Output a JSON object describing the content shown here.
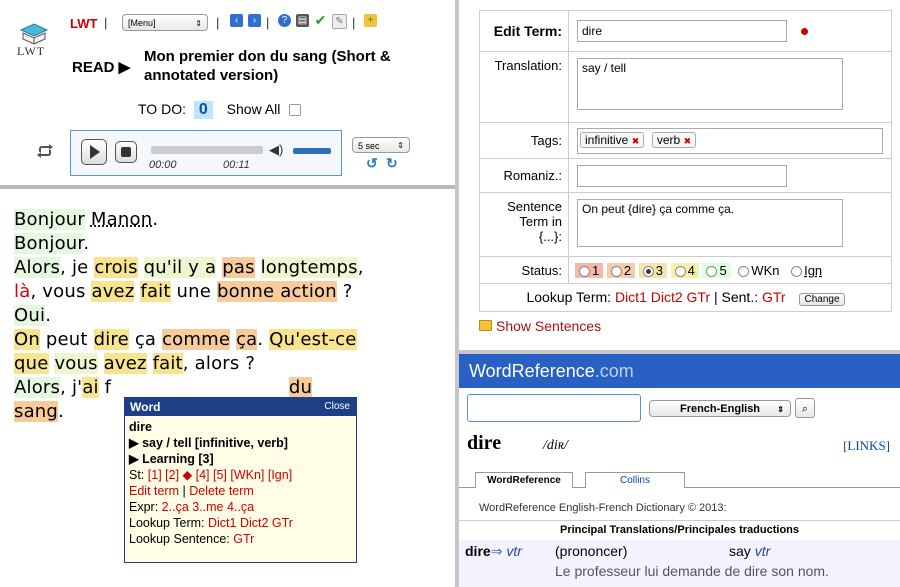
{
  "header": {
    "logo_text": "LWT",
    "app_label": "LWT",
    "menu_select": "[Menu]",
    "read_label": "READ ▶",
    "title": "Mon premier don du sang (Short & annotated version)",
    "todo_label": "TO DO:",
    "todo_count": "0",
    "show_all_label": "Show All"
  },
  "player": {
    "current_time": "00:00",
    "duration": "00:11",
    "progress_fraction": 0,
    "volume_fraction": 0.9,
    "skip_select": "5 sec"
  },
  "reading": {
    "lines": [
      [
        {
          "t": "Bonjour",
          "c": "s5"
        },
        {
          "t": " "
        },
        {
          "t": "Manon",
          "c": "ign"
        },
        {
          "t": "."
        }
      ],
      [
        {
          "t": "Bonjour",
          "c": "s5"
        },
        {
          "t": "."
        }
      ],
      [
        {
          "t": "Alors",
          "c": "s5"
        },
        {
          "t": ", je "
        },
        {
          "t": "crois",
          "c": "s3"
        },
        {
          "t": " "
        },
        {
          "t": "qu'il y a",
          "c": "s4"
        },
        {
          "t": " "
        },
        {
          "t": "pas",
          "c": "s2"
        },
        {
          "t": " "
        },
        {
          "t": "longtemps",
          "c": "s4"
        },
        {
          "t": ","
        }
      ],
      [
        {
          "t": "là",
          "c": "redw"
        },
        {
          "t": ", vous "
        },
        {
          "t": "avez",
          "c": "s3"
        },
        {
          "t": " "
        },
        {
          "t": "fait",
          "c": "s3"
        },
        {
          "t": " une "
        },
        {
          "t": "bonne action",
          "c": "s2"
        },
        {
          "t": " ?"
        }
      ],
      [
        {
          "t": "Oui",
          "c": "s5"
        },
        {
          "t": "."
        }
      ],
      [
        {
          "t": "On",
          "c": "s3"
        },
        {
          "t": " peut "
        },
        {
          "t": "dire",
          "c": "s3"
        },
        {
          "t": " ça "
        },
        {
          "t": "comme",
          "c": "s2"
        },
        {
          "t": " "
        },
        {
          "t": "ça",
          "c": "s2"
        },
        {
          "t": ". "
        },
        {
          "t": "Qu'est-ce",
          "c": "s3"
        }
      ],
      [
        {
          "t": "que",
          "c": "s3"
        },
        {
          "t": " "
        },
        {
          "t": "vous",
          "c": "s4"
        },
        {
          "t": " "
        },
        {
          "t": "avez",
          "c": "s3"
        },
        {
          "t": " "
        },
        {
          "t": "fait",
          "c": "s3"
        },
        {
          "t": ", alors ?"
        }
      ],
      [
        {
          "t": "Alors",
          "c": "s5"
        },
        {
          "t": ", j'"
        },
        {
          "t": "ai",
          "c": "s3"
        },
        {
          "t": " f"
        },
        {
          "t": "                              "
        },
        {
          "t": "du",
          "c": "s2"
        }
      ],
      [
        {
          "t": "sang",
          "c": "s2"
        },
        {
          "t": "."
        }
      ]
    ]
  },
  "popup": {
    "title": "Word",
    "close": "Close",
    "term": "dire",
    "translation": "▶ say / tell [infinitive, verb]",
    "learning": "▶ Learning [3]",
    "status_prefix": "St:",
    "status_links": "[1] [2] ◆ [4] [5] [WKn] [Ign]",
    "edit_term": "Edit term",
    "sep": " | ",
    "delete_term": "Delete term",
    "expr_label": "Expr:",
    "expr_links": "2..ça 3..me 4..ça",
    "lookup_term_label": "Lookup Term:",
    "lookup_term_links": "Dict1 Dict2 GTr",
    "lookup_sentence_label": "Lookup Sentence:",
    "lookup_sentence_link": "GTr"
  },
  "form": {
    "edit_term_label": "Edit Term:",
    "edit_term_value": "dire",
    "translation_label": "Translation:",
    "translation_value": "say / tell",
    "tags_label": "Tags:",
    "tags": [
      "infinitive",
      "verb"
    ],
    "romaniz_label": "Romaniz.:",
    "romaniz_value": "",
    "sentence_label_1": "Sentence",
    "sentence_label_2": "Term in",
    "sentence_label_3": "{...}:",
    "sentence_value": "On peut {dire} ça comme ça.",
    "status_label": "Status:",
    "status_options": [
      "1",
      "2",
      "3",
      "4",
      "5",
      "WKn",
      "Ign"
    ],
    "status_selected": "3",
    "lookup_label": "Lookup Term:",
    "lookup_dicts": "Dict1 Dict2 GTr",
    "lookup_sep": " | Sent.: ",
    "lookup_sent": "GTr",
    "change_button": "Change",
    "show_sentences": "Show Sentences",
    "colors": {
      "status1": "#f5b8a9",
      "status2": "#f5ccaa",
      "status3": "#f5e5aa",
      "status4": "#f5f3ab",
      "status5": "#ddffdd"
    }
  },
  "wordref": {
    "brand": "WordReference",
    "brand_suffix": ".com",
    "search_value": "",
    "lang_select": "French-English",
    "word": "dire",
    "pron": "/diʀ/",
    "links": "[LINKS]",
    "tab_wr": "WordReference",
    "tab_collins": "Collins",
    "copyright": "WordReference English-French Dictionary © 2013:",
    "principal": "Principal Translations/Principales traductions",
    "entry_word": "dire",
    "entry_arrow": "⇒",
    "entry_pos": "vtr",
    "entry_sense": "(prononcer)",
    "entry_trans": "say",
    "entry_trans_pos": "vtr",
    "entry_example": "Le professeur lui demande de dire son nom."
  }
}
